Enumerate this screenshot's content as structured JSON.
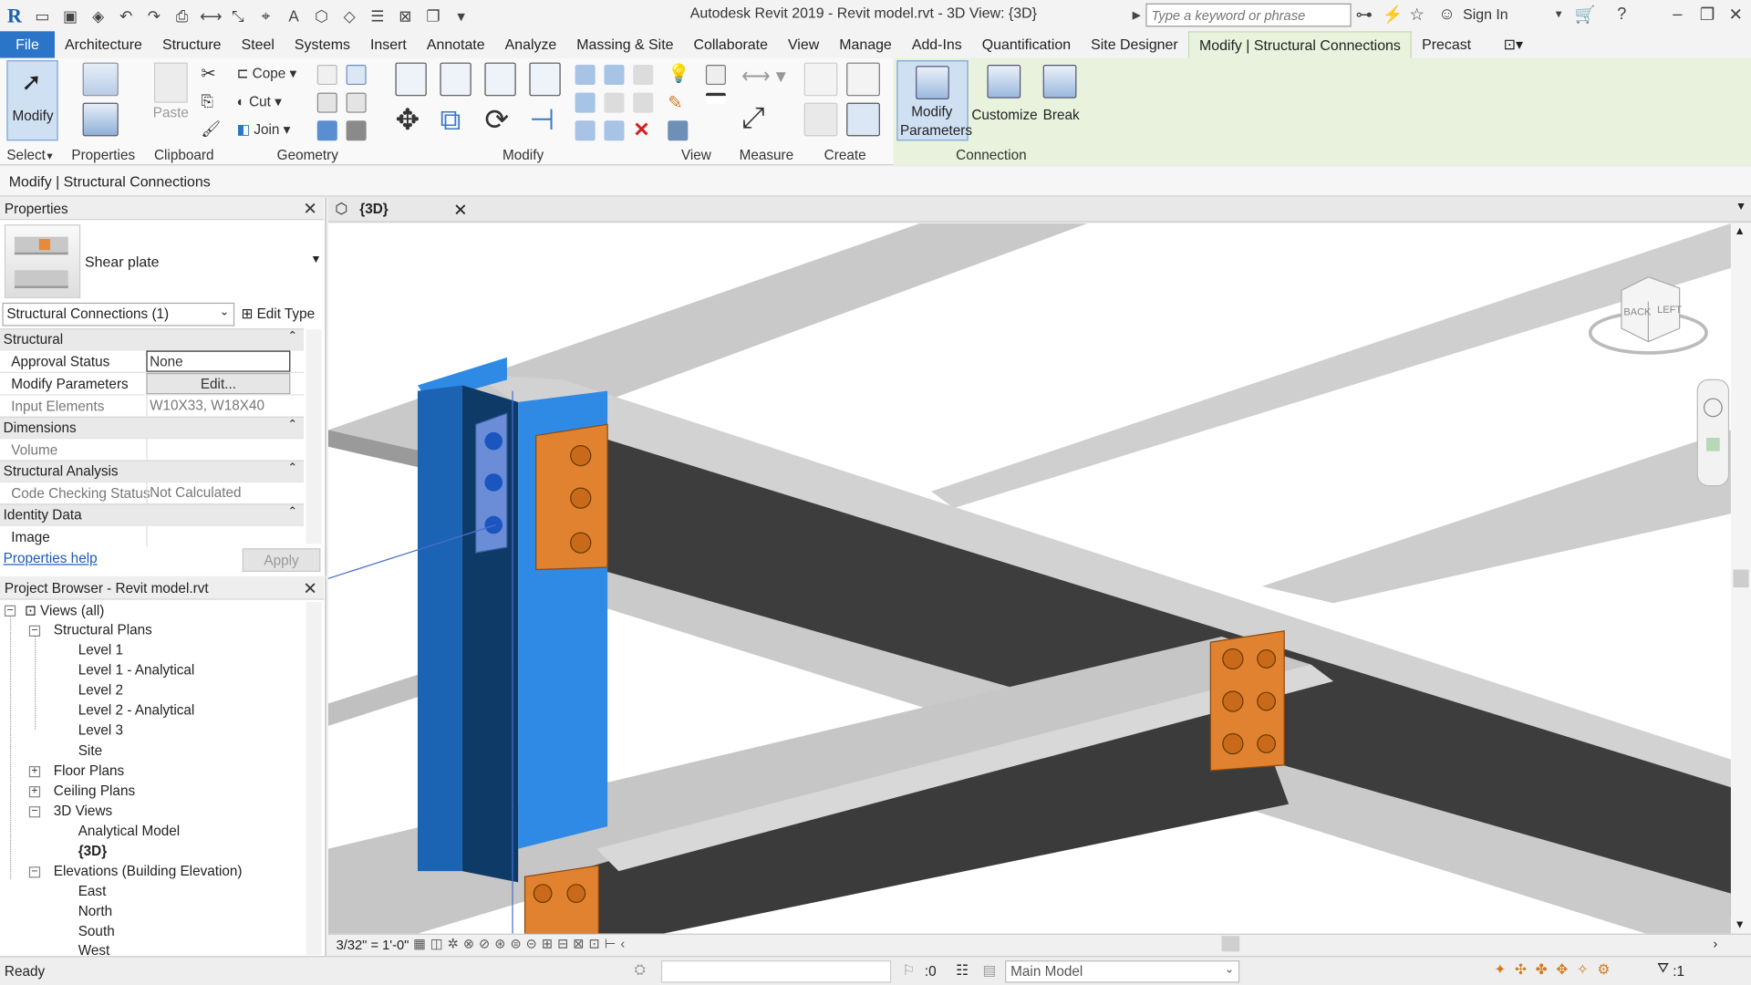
{
  "titlebar": {
    "title": "Autodesk Revit 2019 - Revit model.rvt - 3D View: {3D}",
    "search_placeholder": "Type a keyword or phrase",
    "sign_in": "Sign In"
  },
  "tabs": [
    "File",
    "Architecture",
    "Structure",
    "Steel",
    "Systems",
    "Insert",
    "Annotate",
    "Analyze",
    "Massing & Site",
    "Collaborate",
    "View",
    "Manage",
    "Add-Ins",
    "Quantification",
    "Site Designer",
    "Modify | Structural Connections",
    "Precast"
  ],
  "ribbon": {
    "select": {
      "modify": "Modify",
      "label": "Select"
    },
    "properties": {
      "label": "Properties"
    },
    "clipboard": {
      "paste": "Paste",
      "label": "Clipboard"
    },
    "geometry": {
      "cope": "Cope",
      "cut": "Cut",
      "join": "Join",
      "label": "Geometry"
    },
    "modify": {
      "label": "Modify"
    },
    "view": {
      "label": "View"
    },
    "measure": {
      "label": "Measure"
    },
    "create": {
      "label": "Create"
    },
    "connection": {
      "modify_parameters_1": "Modify",
      "modify_parameters_2": "Parameters",
      "customize": "Customize",
      "break": "Break",
      "label": "Connection"
    }
  },
  "context_bar": "Modify | Structural Connections",
  "properties": {
    "title": "Properties",
    "type_name": "Shear plate",
    "instance_filter": "Structural Connections (1)",
    "edit_type": "Edit Type",
    "groups": {
      "structural": "Structural",
      "dimensions": "Dimensions",
      "structural_analysis": "Structural Analysis",
      "identity": "Identity Data"
    },
    "rows": {
      "approval_k": "Approval Status",
      "approval_v": "None",
      "modparams_k": "Modify Parameters",
      "modparams_v": "Edit...",
      "input_k": "Input Elements",
      "input_v": "W10X33, W18X40",
      "volume_k": "Volume",
      "volume_v": "",
      "code_k": "Code Checking Status",
      "code_v": "Not Calculated",
      "image_k": "Image",
      "image_v": ""
    },
    "help": "Properties help",
    "apply": "Apply"
  },
  "browser": {
    "title": "Project Browser - Revit model.rvt",
    "nodes": {
      "views": "Views (all)",
      "structural_plans": "Structural Plans",
      "level1": "Level 1",
      "level1a": "Level 1 - Analytical",
      "level2": "Level 2",
      "level2a": "Level 2 - Analytical",
      "level3": "Level 3",
      "site": "Site",
      "floor": "Floor Plans",
      "ceiling": "Ceiling Plans",
      "views3d": "3D Views",
      "analytical": "Analytical Model",
      "v3d": "{3D}",
      "elevations": "Elevations (Building Elevation)",
      "east": "East",
      "north": "North",
      "south": "South",
      "west": "West"
    }
  },
  "view": {
    "tab_title": "{3D}",
    "scale": "3/32\" = 1'-0\"",
    "cube_back": "BACK",
    "cube_left": "LEFT"
  },
  "status": {
    "text": "Ready",
    "selection_count": ":0",
    "model": "Main Model",
    "filter": ":1"
  },
  "colors": {
    "file_tab": "#2a75c8",
    "context_tab": "#e8f2dc",
    "selected_column": "#2f8ae6",
    "connection_plate": "#e0822f",
    "beam_flange": "#c9c9c9",
    "beam_web": "#3e3e3e"
  }
}
